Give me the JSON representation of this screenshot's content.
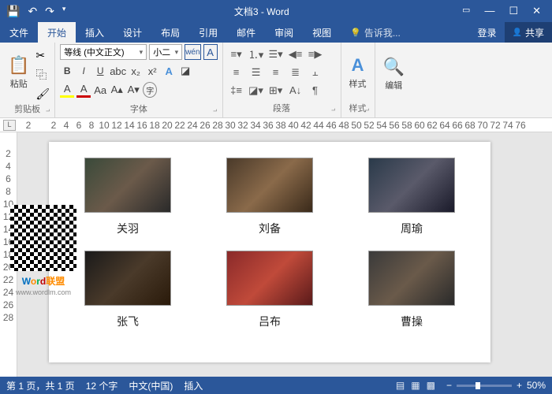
{
  "title": "文档3 - Word",
  "tabs": [
    "文件",
    "开始",
    "插入",
    "设计",
    "布局",
    "引用",
    "邮件",
    "审阅",
    "视图"
  ],
  "active_tab": 1,
  "tellme": "告诉我...",
  "login": "登录",
  "share": "共享",
  "ribbon": {
    "clipboard": {
      "label": "剪贴板",
      "paste": "粘贴"
    },
    "font": {
      "label": "字体",
      "family": "等线 (中文正文)",
      "size": "小二"
    },
    "paragraph": {
      "label": "段落"
    },
    "styles": {
      "label": "样式",
      "btn": "样式"
    },
    "editing": {
      "label": "编辑",
      "btn": "编辑"
    }
  },
  "ruler_corner": "L",
  "ruler_h": [
    "2",
    "",
    "2",
    "4",
    "6",
    "8",
    "10",
    "12",
    "14",
    "16",
    "18",
    "20",
    "22",
    "24",
    "26",
    "28",
    "30",
    "32",
    "34",
    "36",
    "38",
    "40",
    "42",
    "44",
    "46",
    "48",
    "50",
    "52",
    "54",
    "56",
    "58",
    "60",
    "62",
    "64",
    "66",
    "68",
    "70",
    "72",
    "74",
    "76"
  ],
  "ruler_v": [
    "",
    "2",
    "4",
    "6",
    "8",
    "10",
    "12",
    "14",
    "16",
    "18",
    "20",
    "22",
    "24",
    "26",
    "28"
  ],
  "doc": {
    "items": [
      {
        "caption": "关羽"
      },
      {
        "caption": "刘备"
      },
      {
        "caption": "周瑜"
      },
      {
        "caption": "张飞"
      },
      {
        "caption": "吕布"
      },
      {
        "caption": "曹操"
      }
    ]
  },
  "status": {
    "page": "第 1 页，共 1 页",
    "words": "12 个字",
    "lang": "中文(中国)",
    "insert": "插入",
    "zoom": "50%"
  },
  "watermark": {
    "url": "www.wordlm.com"
  }
}
